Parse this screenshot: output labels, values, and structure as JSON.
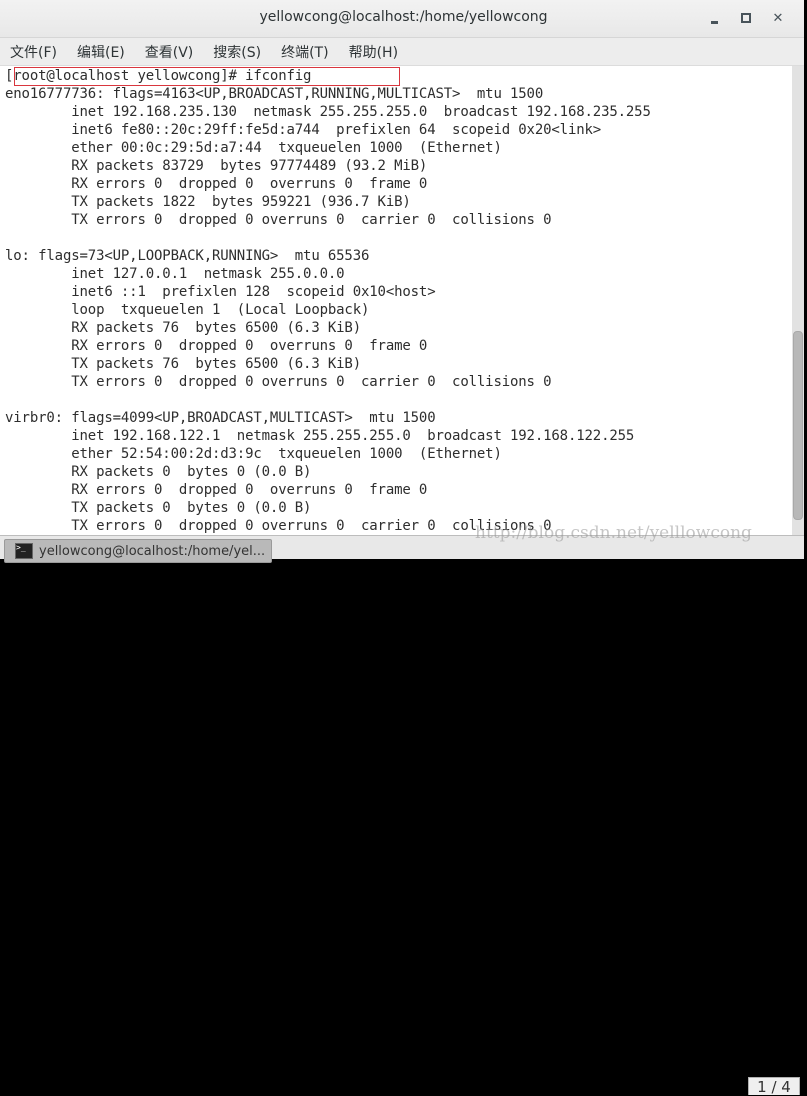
{
  "window": {
    "title": "yellowcong@localhost:/home/yellowcong",
    "controls": [
      {
        "name": "minimize",
        "icon": "minimize-icon"
      },
      {
        "name": "maximize",
        "icon": "maximize-icon"
      },
      {
        "name": "close",
        "icon": "close-icon",
        "glyph": "✕"
      }
    ]
  },
  "menubar": {
    "items": [
      {
        "label": "文件(F)"
      },
      {
        "label": "编辑(E)"
      },
      {
        "label": "查看(V)"
      },
      {
        "label": "搜索(S)"
      },
      {
        "label": "终端(T)"
      },
      {
        "label": "帮助(H)"
      }
    ]
  },
  "terminal": {
    "prompt": "[root@localhost yellowcong]# ifconfig",
    "highlight_color": "#d9363e",
    "lines": [
      "[root@localhost yellowcong]# ifconfig",
      "eno16777736: flags=4163<UP,BROADCAST,RUNNING,MULTICAST>  mtu 1500",
      "        inet 192.168.235.130  netmask 255.255.255.0  broadcast 192.168.235.255",
      "        inet6 fe80::20c:29ff:fe5d:a744  prefixlen 64  scopeid 0x20<link>",
      "        ether 00:0c:29:5d:a7:44  txqueuelen 1000  (Ethernet)",
      "        RX packets 83729  bytes 97774489 (93.2 MiB)",
      "        RX errors 0  dropped 0  overruns 0  frame 0",
      "        TX packets 1822  bytes 959221 (936.7 KiB)",
      "        TX errors 0  dropped 0 overruns 0  carrier 0  collisions 0",
      "",
      "lo: flags=73<UP,LOOPBACK,RUNNING>  mtu 65536",
      "        inet 127.0.0.1  netmask 255.0.0.0",
      "        inet6 ::1  prefixlen 128  scopeid 0x10<host>",
      "        loop  txqueuelen 1  (Local Loopback)",
      "        RX packets 76  bytes 6500 (6.3 KiB)",
      "        RX errors 0  dropped 0  overruns 0  frame 0",
      "        TX packets 76  bytes 6500 (6.3 KiB)",
      "        TX errors 0  dropped 0 overruns 0  carrier 0  collisions 0",
      "",
      "virbr0: flags=4099<UP,BROADCAST,MULTICAST>  mtu 1500",
      "        inet 192.168.122.1  netmask 255.255.255.0  broadcast 192.168.122.255",
      "        ether 52:54:00:2d:d3:9c  txqueuelen 1000  (Ethernet)",
      "        RX packets 0  bytes 0 (0.0 B)",
      "        RX errors 0  dropped 0  overruns 0  frame 0",
      "        TX packets 0  bytes 0 (0.0 B)",
      "        TX errors 0  dropped 0 overruns 0  carrier 0  collisions 0"
    ],
    "scroll_position_fraction": 0.6
  },
  "taskbar": {
    "task_label": "yellowcong@localhost:/home/yel...",
    "task_icon": "terminal-icon",
    "pager": "1 / 4"
  },
  "watermark": "http://blog.csdn.net/yelllowcong"
}
